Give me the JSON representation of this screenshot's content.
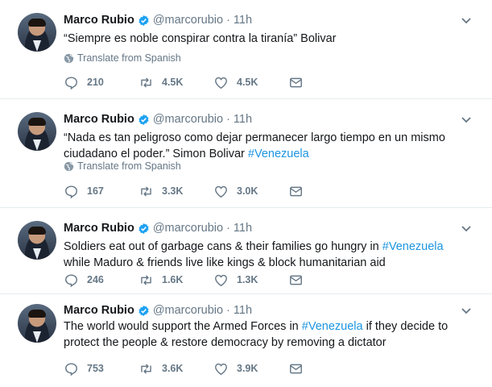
{
  "colors": {
    "accent": "#1b95e0",
    "muted": "#657786",
    "text": "#14171a",
    "divider": "#e6ecf0"
  },
  "icons": [
    "verified-badge-icon",
    "chevron-down-icon",
    "globe-icon",
    "reply-icon",
    "retweet-icon",
    "like-icon",
    "message-icon"
  ],
  "tweets": [
    {
      "name": "Marco Rubio",
      "handle": "@marcorubio",
      "sep": "·",
      "time": "11h",
      "text_before": "“Siempre es noble conspirar contra la tiranía” Bolivar",
      "hashtag": "",
      "text_after": "",
      "translate": "Translate from Spanish",
      "replies": "210",
      "retweets": "4.5K",
      "likes": "4.5K"
    },
    {
      "name": "Marco Rubio",
      "handle": "@marcorubio",
      "sep": "·",
      "time": "11h",
      "text_before": "“Nada es tan peligroso como dejar permanecer largo tiempo en un mismo ciudadano el poder.” Simon Bolivar ",
      "hashtag": "#Venezuela",
      "text_after": "",
      "translate": "Translate from Spanish",
      "replies": "167",
      "retweets": "3.3K",
      "likes": "3.0K"
    },
    {
      "name": "Marco Rubio",
      "handle": "@marcorubio",
      "sep": "·",
      "time": "11h",
      "text_before": "Soldiers eat out of garbage cans & their families go hungry in ",
      "hashtag": "#Venezuela",
      "text_after": " while Maduro & friends live like kings & block humanitarian aid",
      "translate": "",
      "replies": "246",
      "retweets": "1.6K",
      "likes": "1.3K"
    },
    {
      "name": "Marco Rubio",
      "handle": "@marcorubio",
      "sep": "·",
      "time": "11h",
      "text_before": "The world would support the Armed Forces in ",
      "hashtag": "#Venezuela",
      "text_after": " if they decide to protect the people & restore democracy by removing a dictator",
      "translate": "",
      "replies": "753",
      "retweets": "3.6K",
      "likes": "3.9K"
    }
  ]
}
